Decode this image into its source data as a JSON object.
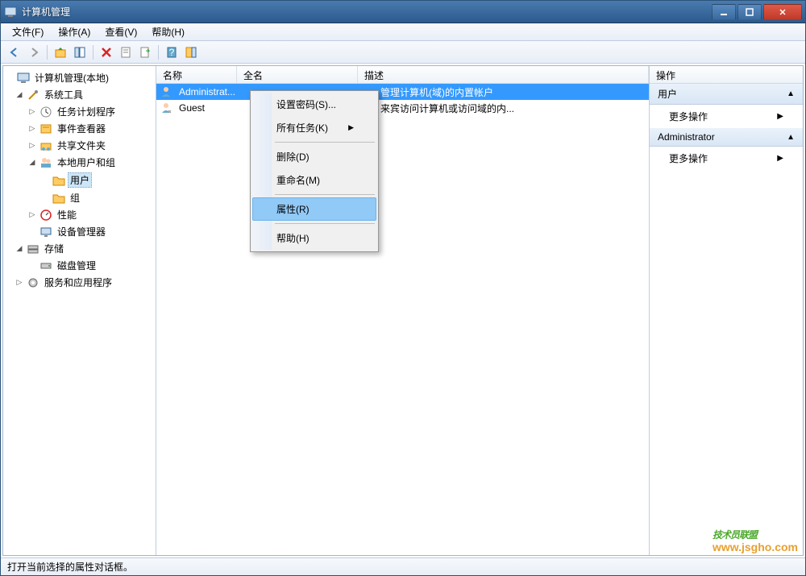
{
  "window": {
    "title": "计算机管理"
  },
  "menubar": [
    "文件(F)",
    "操作(A)",
    "查看(V)",
    "帮助(H)"
  ],
  "tree": {
    "root": "计算机管理(本地)",
    "system_tools": "系统工具",
    "task_scheduler": "任务计划程序",
    "event_viewer": "事件查看器",
    "shared_folders": "共享文件夹",
    "local_users_groups": "本地用户和组",
    "users": "用户",
    "groups": "组",
    "performance": "性能",
    "device_manager": "设备管理器",
    "storage": "存储",
    "disk_management": "磁盘管理",
    "services_apps": "服务和应用程序"
  },
  "list": {
    "headers": {
      "name": "名称",
      "fullname": "全名",
      "desc": "描述"
    },
    "rows": [
      {
        "name": "Administrat...",
        "fullname": "",
        "desc": "管理计算机(域)的内置帐户",
        "selected": true
      },
      {
        "name": "Guest",
        "fullname": "",
        "desc": "来宾访问计算机或访问域的内...",
        "selected": false
      }
    ]
  },
  "context_menu": {
    "set_password": "设置密码(S)...",
    "all_tasks": "所有任务(K)",
    "delete": "删除(D)",
    "rename": "重命名(M)",
    "properties": "属性(R)",
    "help": "帮助(H)"
  },
  "actions": {
    "header": "操作",
    "section_users": "用户",
    "more_actions": "更多操作",
    "section_admin": "Administrator"
  },
  "statusbar": "打开当前选择的属性对话框。",
  "watermark": {
    "line1": "技术员联盟",
    "line2": "www.jsgho.com"
  }
}
